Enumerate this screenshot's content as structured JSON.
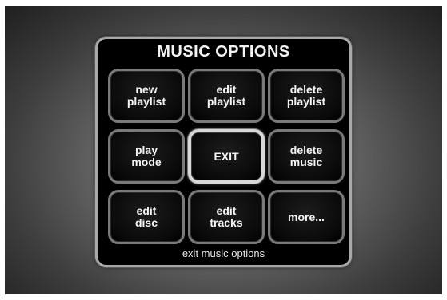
{
  "menu": {
    "title": "MUSIC OPTIONS",
    "buttons": [
      {
        "label": "new\nplaylist"
      },
      {
        "label": "edit\nplaylist"
      },
      {
        "label": "delete\nplaylist"
      },
      {
        "label": "play\nmode"
      },
      {
        "label": "EXIT"
      },
      {
        "label": "delete\nmusic"
      },
      {
        "label": "edit\ndisc"
      },
      {
        "label": "edit\ntracks"
      },
      {
        "label": "more..."
      }
    ],
    "selected_button": "EXIT",
    "footer": "exit music options"
  }
}
